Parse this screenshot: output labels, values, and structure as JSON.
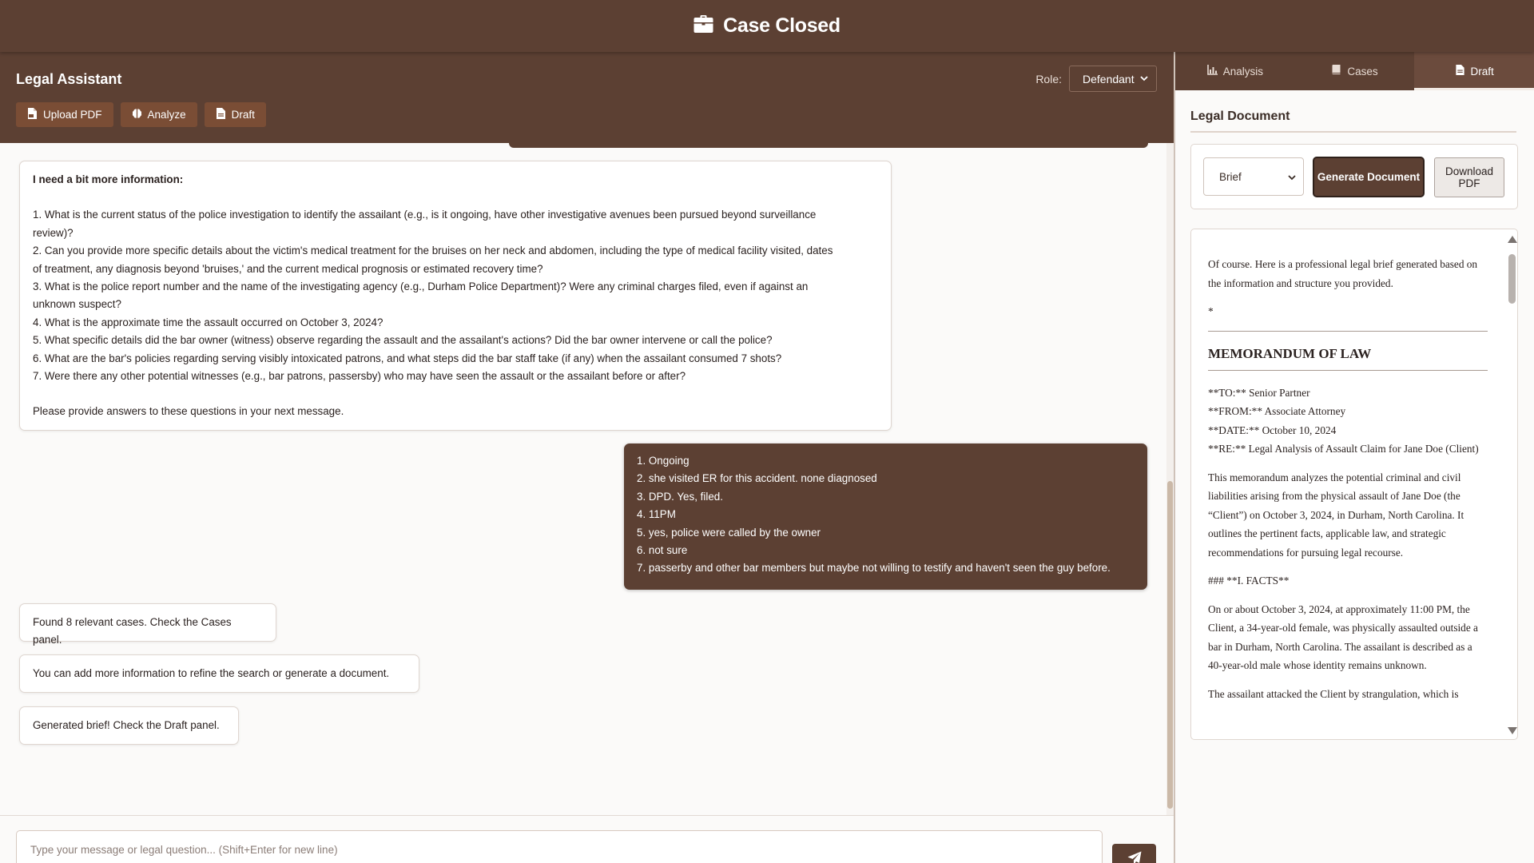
{
  "app": {
    "title": "Case Closed",
    "icon": "briefcase-icon"
  },
  "chat_header": {
    "title": "Legal Assistant",
    "role_label": "Role:",
    "role_value": "Defendant",
    "buttons": [
      {
        "label": "Upload PDF",
        "icon": "pdf-file-icon"
      },
      {
        "label": "Analyze",
        "icon": "brain-icon"
      },
      {
        "label": "Draft",
        "icon": "document-icon"
      }
    ]
  },
  "messages": {
    "bot_info": {
      "heading": "I need a bit more information:",
      "questions": [
        "1. What is the current status of the police investigation to identify the assailant (e.g., is it ongoing, have other investigative avenues been pursued beyond surveillance",
        "review)?",
        "2. Can you provide more specific details about the victim's medical treatment for the bruises on her neck and abdomen, including the type of medical facility visited, dates",
        "of treatment, any diagnosis beyond 'bruises,' and the current medical prognosis or estimated recovery time?",
        "3. What is the police report number and the name of the investigating agency (e.g., Durham Police Department)? Were any criminal charges filed, even if against an",
        "unknown suspect?",
        "4. What is the approximate time the assault occurred on October 3, 2024?",
        "5. What specific details did the bar owner (witness) observe regarding the assault and the assailant's actions? Did the bar owner intervene or call the police?",
        "6. What are the bar's policies regarding serving visibly intoxicated patrons, and what steps did the bar staff take (if any) when the assailant consumed 7 shots?",
        "7. Were there any other potential witnesses (e.g., bar patrons, passersby) who may have seen the assault or the assailant before or after?"
      ],
      "closing": "Please provide answers to these questions in your next message."
    },
    "user_answers": [
      "1. Ongoing",
      "2. she visited ER for this accident. none diagnosed",
      "3. DPD. Yes, filed.",
      "4. 11PM",
      "5. yes, police were called by the owner",
      "6. not sure",
      "7. passerby and other bar members but maybe not willing to testify and haven't seen the guy before."
    ],
    "bot_found": "Found 8 relevant cases. Check the Cases panel.",
    "bot_refine": "You can add more information to refine the search or generate a document.",
    "bot_generated": "Generated brief! Check the Draft panel."
  },
  "composer": {
    "placeholder": "Type your message or legal question... (Shift+Enter for new line)",
    "send_icon": "paper-plane-icon"
  },
  "right_panel": {
    "tabs": [
      {
        "label": "Analysis",
        "icon": "chart-icon",
        "active": false
      },
      {
        "label": "Cases",
        "icon": "book-icon",
        "active": false
      },
      {
        "label": "Draft",
        "icon": "document-icon",
        "active": true
      }
    ],
    "title": "Legal Document",
    "doc_type": "Brief",
    "generate_label": "Generate Document",
    "download_label": "Download PDF",
    "document": {
      "intro": "Of course. Here is a professional legal brief generated based on the information and structure you provided.",
      "asterisk": "*",
      "heading": "MEMORANDUM OF LAW",
      "to": "**TO:** Senior Partner",
      "from": "**FROM:** Associate Attorney",
      "date": "**DATE:** October 10, 2024",
      "re": "**RE:** Legal Analysis of Assault Claim for Jane Doe (Client)",
      "summary": "This memorandum analyzes the potential criminal and civil liabilities arising from the physical assault of Jane Doe (the “Client”) on October 3, 2024, in Durham, North Carolina. It outlines the pertinent facts, applicable law, and strategic recommendations for pursuing legal recourse.",
      "facts_heading": "### **I. FACTS**",
      "facts": "On or about October 3, 2024, at approximately 11:00 PM, the Client, a 34-year-old female, was physically assaulted outside a bar in Durham, North Carolina. The assailant is described as a 40-year-old male whose identity remains unknown.",
      "cutoff": "The assailant attacked the Client by strangulation, which is"
    }
  },
  "colors": {
    "brand": "#5c4033",
    "button": "#7a4d35",
    "background": "#fbfaf9"
  }
}
